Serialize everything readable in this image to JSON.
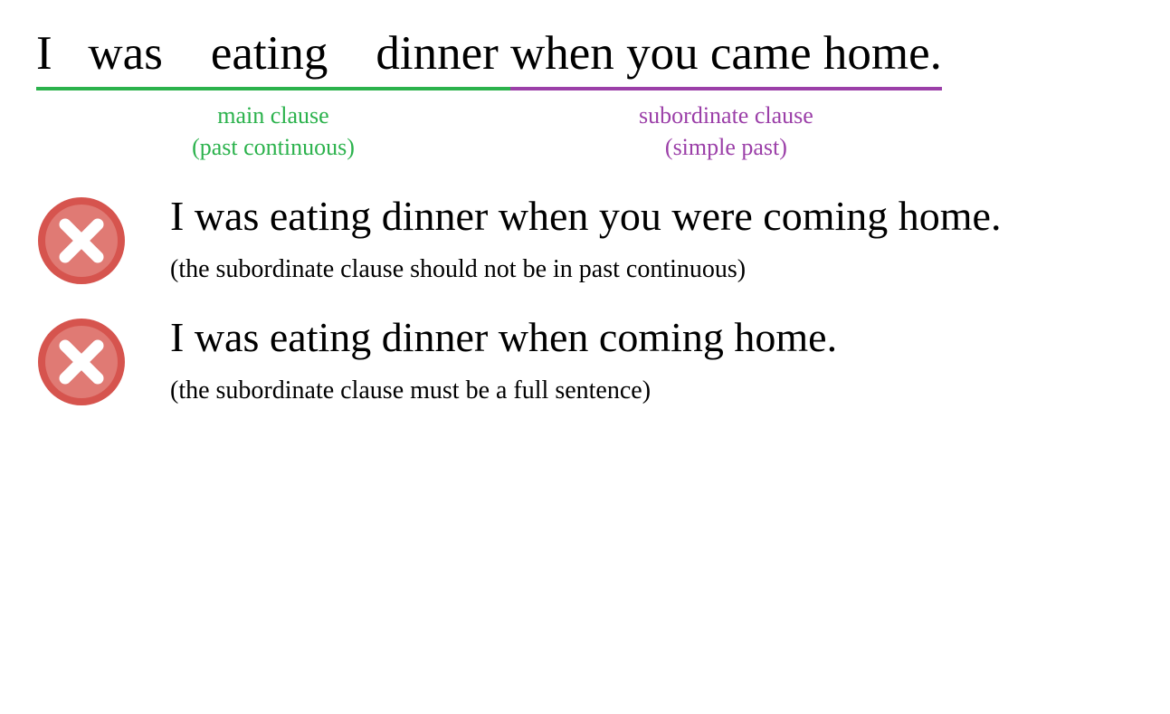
{
  "colors": {
    "green": "#2bb24c",
    "purple": "#9b3fa8",
    "xFill": "#d6544e",
    "xInner": "#e8a8a4",
    "xCross": "#ffffff"
  },
  "sentence": {
    "mainClause": {
      "words": [
        "I",
        "was",
        "eating",
        "dinner"
      ],
      "label1": "main clause",
      "label2": "(past continuous)"
    },
    "subordinateClause": {
      "words": [
        "when",
        "you",
        "came",
        "home."
      ],
      "label1": "subordinate clause",
      "label2": "(simple past)"
    }
  },
  "examples": [
    {
      "sentence": "I was eating dinner when you were coming home.",
      "note": "(the subordinate clause should not be in past continuous)"
    },
    {
      "sentence": "I was eating dinner when coming home.",
      "note": "(the subordinate clause must be a full sentence)"
    }
  ]
}
